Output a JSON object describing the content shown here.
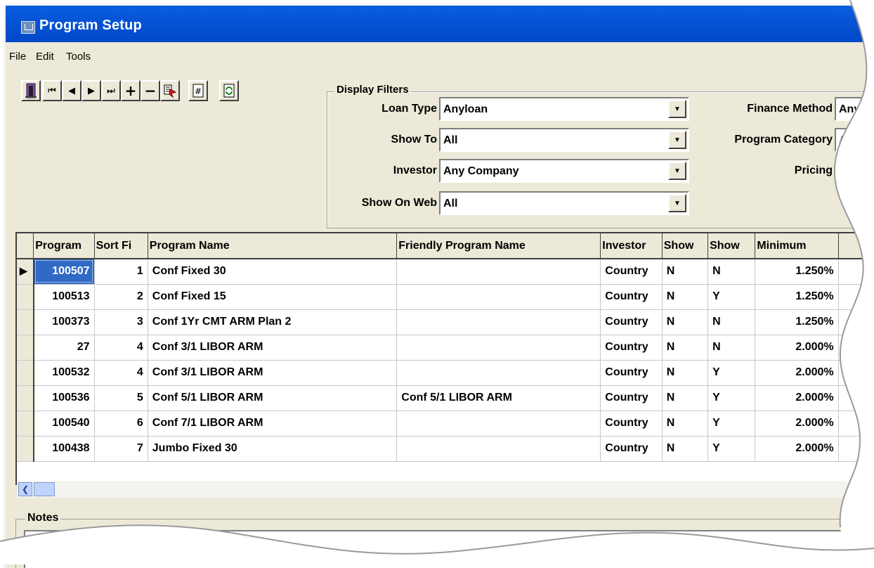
{
  "window": {
    "title": "Program Setup"
  },
  "menu": [
    "File",
    "Edit",
    "Tools"
  ],
  "toolbar": {
    "exit": "exit-door-icon",
    "first": "⏮",
    "prev": "◀",
    "next": "▶",
    "last": "⏭",
    "add": "+",
    "remove": "−",
    "copy_icon": "copy-record-icon",
    "number_icon": "number-icon",
    "refresh_icon": "refresh-icon"
  },
  "filters": {
    "legend": "Display Filters",
    "loan_type": {
      "label": "Loan Type",
      "value": "Anyloan"
    },
    "show_to": {
      "label": "Show To",
      "value": "All"
    },
    "investor": {
      "label": "Investor",
      "value": "Any Company"
    },
    "show_on_web": {
      "label": "Show On Web",
      "value": "All"
    },
    "finance_method": {
      "label": "Finance Method",
      "value": "Any"
    },
    "program_category": {
      "label": "Program Category",
      "value": "A"
    },
    "pricing": {
      "label": "Pricing"
    }
  },
  "grid": {
    "columns": [
      "Program",
      "Sort Fi",
      "Program Name",
      "Friendly Program Name",
      "Investor",
      "Show",
      "Show",
      "Minimum"
    ],
    "rows": [
      {
        "program": "100507",
        "sort": "1",
        "name": "Conf Fixed 30",
        "friendly": "",
        "investor": "Country",
        "show1": "N",
        "show2": "N",
        "minimum": "1.250%"
      },
      {
        "program": "100513",
        "sort": "2",
        "name": "Conf Fixed 15",
        "friendly": "",
        "investor": "Country",
        "show1": "N",
        "show2": "Y",
        "minimum": "1.250%"
      },
      {
        "program": "100373",
        "sort": "3",
        "name": "Conf 1Yr CMT ARM Plan 2",
        "friendly": "",
        "investor": "Country",
        "show1": "N",
        "show2": "N",
        "minimum": "1.250%"
      },
      {
        "program": "27",
        "sort": "4",
        "name": "Conf 3/1 LIBOR ARM",
        "friendly": "",
        "investor": "Country",
        "show1": "N",
        "show2": "N",
        "minimum": "2.000%"
      },
      {
        "program": "100532",
        "sort": "4",
        "name": "Conf 3/1 LIBOR ARM",
        "friendly": "",
        "investor": "Country",
        "show1": "N",
        "show2": "Y",
        "minimum": "2.000%"
      },
      {
        "program": "100536",
        "sort": "5",
        "name": "Conf 5/1 LIBOR ARM",
        "friendly": "Conf 5/1 LIBOR ARM",
        "investor": "Country",
        "show1": "N",
        "show2": "Y",
        "minimum": "2.000%"
      },
      {
        "program": "100540",
        "sort": "6",
        "name": "Conf 7/1 LIBOR ARM",
        "friendly": "",
        "investor": "Country",
        "show1": "N",
        "show2": "Y",
        "minimum": "2.000%"
      },
      {
        "program": "100438",
        "sort": "7",
        "name": "Jumbo Fixed 30",
        "friendly": "",
        "investor": "Country",
        "show1": "N",
        "show2": "Y",
        "minimum": "2.000%"
      }
    ]
  },
  "notes": {
    "legend": "Notes"
  }
}
